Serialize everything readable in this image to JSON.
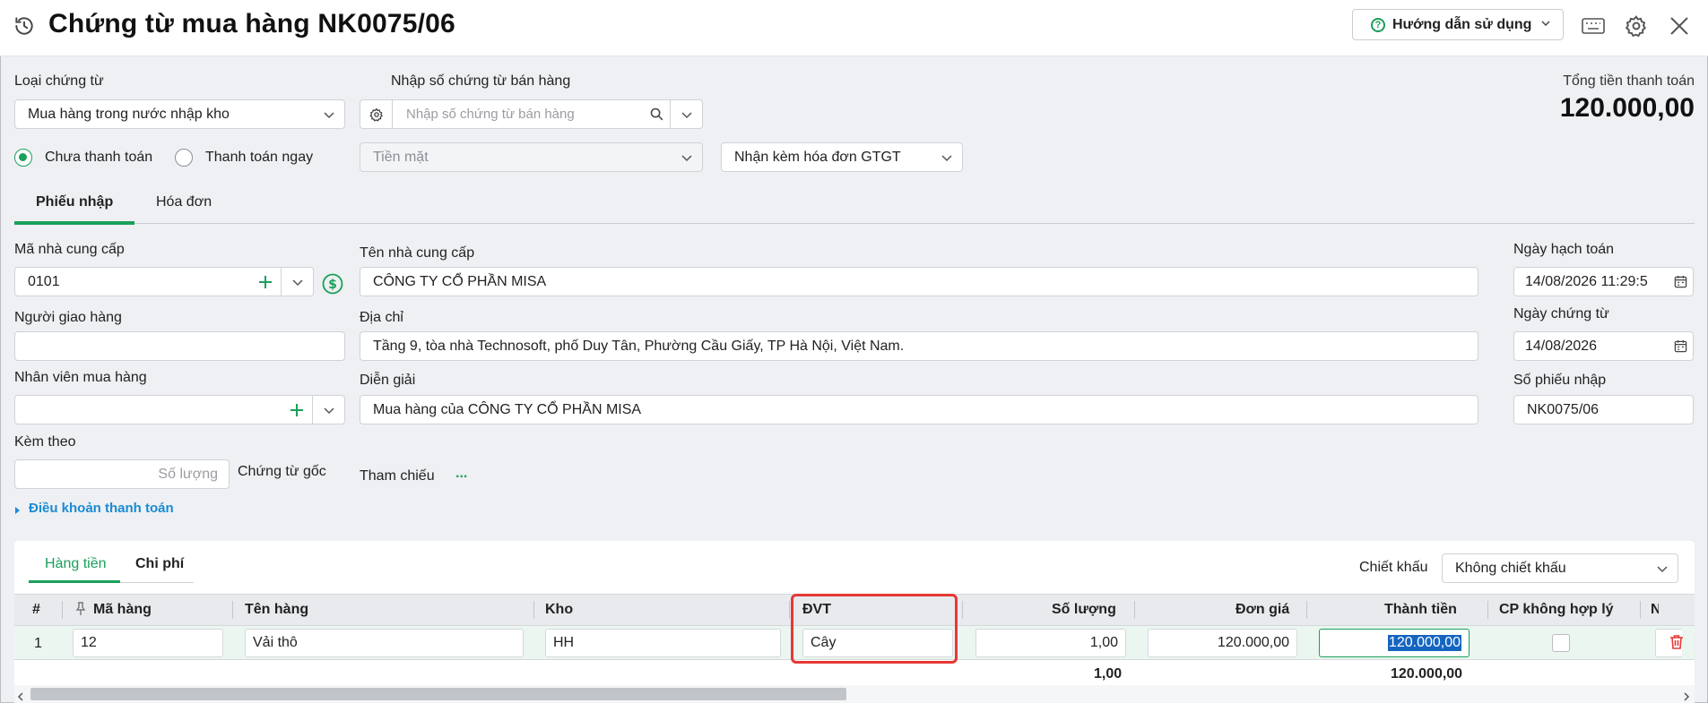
{
  "header": {
    "title": "Chứng từ mua hàng NK0075/06",
    "guide_label": "Hướng dẫn sử dụng"
  },
  "form": {
    "doc_type_label": "Loại chứng từ",
    "doc_type_value": "Mua hàng trong nước nhập kho",
    "sales_doc_label": "Nhập số chứng từ bán hàng",
    "sales_doc_placeholder": "Nhập số chứng từ bán hàng",
    "total_label": "Tổng tiền thanh toán",
    "total_value": "120.000,00",
    "radio_unpaid": "Chưa thanh toán",
    "radio_pay_now": "Thanh toán ngay",
    "payment_method": "Tiền mặt",
    "invoice_option": "Nhận kèm hóa đơn GTGT"
  },
  "tabs": [
    "Phiếu nhập",
    "Hóa đơn"
  ],
  "supplier": {
    "code_label": "Mã nhà cung cấp",
    "code_value": "0101",
    "name_label": "Tên nhà cung cấp",
    "name_value": "CÔNG TY CỔ PHẦN MISA",
    "deliverer_label": "Người giao hàng",
    "address_label": "Địa chỉ",
    "address_value": "Tầng 9, tòa nhà Technosoft, phố Duy Tân, Phường Cầu Giấy, TP Hà Nội, Việt Nam.",
    "buyer_label": "Nhân viên mua hàng",
    "desc_label": "Diễn giải",
    "desc_value": "Mua hàng của CÔNG TY CỔ PHẦN MISA",
    "attach_label": "Kèm theo",
    "qty_placeholder": "Số lượng",
    "origin_doc_label": "Chứng từ gốc",
    "reference_label": "Tham chiếu",
    "reference_more": "...",
    "payment_terms": "Điều khoản thanh toán"
  },
  "dates": {
    "posting_label": "Ngày hạch toán",
    "posting_value": "14/08/2026 11:29:5",
    "doc_date_label": "Ngày chứng từ",
    "doc_date_value": "14/08/2026",
    "receipt_no_label": "Số phiếu nhập",
    "receipt_no_value": "NK0075/06"
  },
  "grid": {
    "subtabs": [
      "Hàng tiền",
      "Chi phí"
    ],
    "discount_label": "Chiết khấu",
    "discount_value": "Không chiết khấu",
    "columns": [
      "#",
      "Mã hàng",
      "Tên hàng",
      "Kho",
      "ĐVT",
      "Số lượng",
      "Đơn giá",
      "Thành tiền",
      "CP không hợp lý",
      "N"
    ],
    "row": {
      "index": "1",
      "code": "12",
      "name": "Vải thô",
      "warehouse": "HH",
      "unit": "Cây",
      "qty": "1,00",
      "price": "120.000,00",
      "amount": "120.000,00"
    },
    "totals": {
      "qty": "1,00",
      "amount": "120.000,00"
    }
  },
  "colors": {
    "accent": "#19a05a",
    "highlight": "#e53935",
    "link": "#1a8ad3"
  }
}
